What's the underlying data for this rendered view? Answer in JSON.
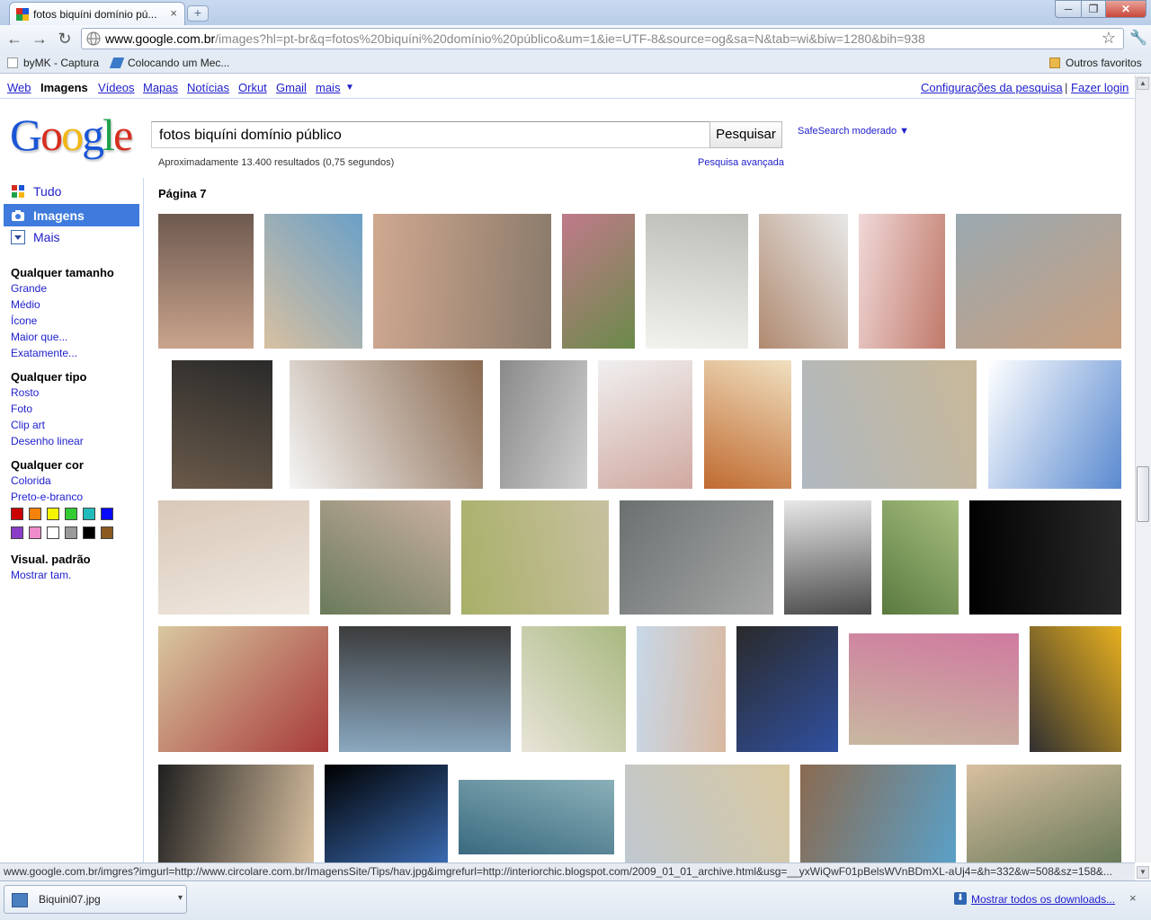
{
  "browser": {
    "tab_title": "fotos biquíni domínio pú...",
    "url_domain": "www.google.com.br",
    "url_path": "/images?hl=pt-br&q=fotos%20biquíni%20domínio%20público&um=1&ie=UTF-8&source=og&sa=N&tab=wi&biw=1280&bih=938",
    "close_glyph": "×",
    "new_tab_glyph": "+",
    "minimize_glyph": "─",
    "maximize_glyph": "❐",
    "window_close_glyph": "✕",
    "back_glyph": "←",
    "forward_glyph": "→",
    "reload_glyph": "↻",
    "star_glyph": "☆",
    "wrench_glyph": "🔧"
  },
  "bookmarks": {
    "items": [
      "byMK - Captura",
      "Colocando um Mec..."
    ],
    "other": "Outros favoritos"
  },
  "gbar": {
    "links": [
      "Web",
      "Imagens",
      "Vídeos",
      "Mapas",
      "Notícias",
      "Orkut",
      "Gmail",
      "mais"
    ],
    "more_arrow": "▼",
    "settings": "Configurações da pesquisa",
    "separator": "|",
    "login": "Fazer login"
  },
  "logo": {
    "letters": [
      "G",
      "o",
      "o",
      "g",
      "l",
      "e"
    ],
    "colors": [
      "#1a55d6",
      "#d62d20",
      "#f3b612",
      "#1a55d6",
      "#1ea14a",
      "#d62d20"
    ]
  },
  "search": {
    "query": "fotos biquíni domínio público",
    "button": "Pesquisar",
    "safesearch": "SafeSearch moderado ▼",
    "stats": "Aproximadamente 13.400 resultados (0,75 segundos)",
    "advanced": "Pesquisa avançada"
  },
  "nav": {
    "all": "Tudo",
    "images": "Imagens",
    "more": "Mais"
  },
  "filters": {
    "size_head": "Qualquer tamanho",
    "sizes": [
      "Grande",
      "Médio",
      "Ícone",
      "Maior que...",
      "Exatamente..."
    ],
    "type_head": "Qualquer tipo",
    "types": [
      "Rosto",
      "Foto",
      "Clip art",
      "Desenho linear"
    ],
    "color_head": "Qualquer cor",
    "colors": [
      "Colorida",
      "Preto-e-branco"
    ],
    "swatches": [
      "#cc0000",
      "#f5820a",
      "#f5f500",
      "#33cc33",
      "#22bbbb",
      "#0a0aff",
      "#8a3ec8",
      "#f08ccc",
      "#ffffff",
      "#9a9a9a",
      "#000000",
      "#8a5a20"
    ],
    "view_head": "Visual. padrão",
    "view_link": "Mostrar tam."
  },
  "results": {
    "page_label": "Página 7",
    "thumbs": [
      {
        "c1": "#c9a48c",
        "c2": "#6e5a50"
      },
      {
        "c1": "#d8c0a0",
        "c2": "#6aa0c8"
      },
      {
        "c1": "#d0a890",
        "c2": "#8a7a6a"
      },
      {
        "c1": "#c07a8a",
        "c2": "#6b8a4a"
      },
      {
        "c1": "#f2f2ee",
        "c2": "#bdbdb8"
      },
      {
        "c1": "#b08a70",
        "c2": "#e8e8e8"
      },
      {
        "c1": "#f0d8d8",
        "c2": "#c07a6a"
      },
      {
        "c1": "#9aa8b0",
        "c2": "#c8a080"
      },
      {
        "c1": "#6a5a4a",
        "c2": "#2a2a2a"
      },
      {
        "c1": "#f5f5f5",
        "c2": "#8a6a50"
      },
      {
        "c1": "#8a8a8a",
        "c2": "#d0d0d0"
      },
      {
        "c1": "#f0f0f0",
        "c2": "#d0a8a0"
      },
      {
        "c1": "#c06a30",
        "c2": "#f0e0c0"
      },
      {
        "c1": "#b0b8c0",
        "c2": "#c8b898"
      },
      {
        "c1": "#ffffff",
        "c2": "#5a8ad0"
      },
      {
        "c1": "#d8c8b8",
        "c2": "#f0e8e0"
      },
      {
        "c1": "#6a7a5a",
        "c2": "#c8b0a0"
      },
      {
        "c1": "#a8b068",
        "c2": "#c8c0a0"
      },
      {
        "c1": "#6a7070",
        "c2": "#a8a8a8"
      },
      {
        "c1": "#e8e8e8",
        "c2": "#4a4a4a"
      },
      {
        "c1": "#5a7a40",
        "c2": "#a8c080"
      },
      {
        "c1": "#000000",
        "c2": "#2a2a2a"
      },
      {
        "c1": "#d8c8a0",
        "c2": "#a83a3a"
      },
      {
        "c1": "#8aa8c0",
        "c2": "#3a3a3a"
      },
      {
        "c1": "#e8e4d8",
        "c2": "#a8b880"
      },
      {
        "c1": "#c8d8e8",
        "c2": "#d8b8a0"
      },
      {
        "c1": "#2a2a2a",
        "c2": "#3050a0"
      },
      {
        "c1": "#c8b8a0",
        "c2": "#d07aa0"
      },
      {
        "c1": "#303030",
        "c2": "#e8b020"
      },
      {
        "c1": "#202020",
        "c2": "#d8c0a0"
      },
      {
        "c1": "#000000",
        "c2": "#3a6ab0"
      },
      {
        "c1": "#3a6a80",
        "c2": "#8ab0b8"
      },
      {
        "c1": "#c0c8d0",
        "c2": "#d8c8a0"
      },
      {
        "c1": "#8a6a50",
        "c2": "#5aa0c8"
      },
      {
        "c1": "#d8c0a0",
        "c2": "#6a7a5a"
      }
    ]
  },
  "status": {
    "text": "www.google.com.br/imgres?imgurl=http://www.circolare.com.br/ImagensSite/Tips/hav.jpg&imgrefurl=http://interiorchic.blogspot.com/2009_01_01_archive.html&usg=__yxWiQwF01pBelsWVnBDmXL-aUj4=&h=332&w=508&sz=158&..."
  },
  "downloads": {
    "file": "Biquini07.jpg",
    "menu_arrow": "▾",
    "show_all": "Mostrar todos os downloads...",
    "download_glyph": "⬇",
    "close_glyph": "×"
  }
}
